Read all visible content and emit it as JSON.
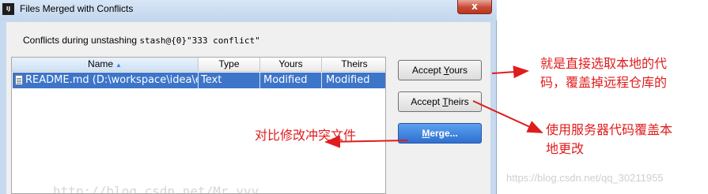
{
  "window": {
    "title": "Files Merged with Conflicts",
    "app_icon_text": "IJ",
    "close_glyph": "x"
  },
  "dialog": {
    "conflicts_prefix": "Conflicts during unstashing ",
    "stash_ref": "stash@{0}\"333 conflict\""
  },
  "table": {
    "columns": [
      {
        "label": "Name",
        "sorted": "ascending"
      },
      {
        "label": "Type"
      },
      {
        "label": "Yours"
      },
      {
        "label": "Theirs"
      }
    ],
    "rows": [
      {
        "name": "README.md (D:\\workspace\\idea\\e",
        "type": "Text",
        "yours": "Modified",
        "theirs": "Modified",
        "selected": true,
        "icon": "text-file-icon"
      }
    ]
  },
  "buttons": {
    "accept_yours_prefix": "Accept ",
    "accept_yours_mnemonic": "Y",
    "accept_yours_suffix": "ours",
    "accept_theirs_prefix": "Accept ",
    "accept_theirs_mnemonic": "T",
    "accept_theirs_suffix": "heirs",
    "merge_mnemonic": "M",
    "merge_suffix": "erge..."
  },
  "annotations": {
    "accept_yours_note_line1": "就是直接选取本地的代",
    "accept_yours_note_line2": "码，覆盖掉远程仓库的",
    "accept_theirs_note_line1": "使用服务器代码覆盖本",
    "accept_theirs_note_line2": "地更改",
    "merge_note": "对比修改冲突文件",
    "arrow_color": "#e01c1c"
  },
  "watermarks": {
    "blog": "http://blog.csdn.net/Mr_yyy",
    "corner": "https://blog.csdn.net/qq_30211955"
  }
}
